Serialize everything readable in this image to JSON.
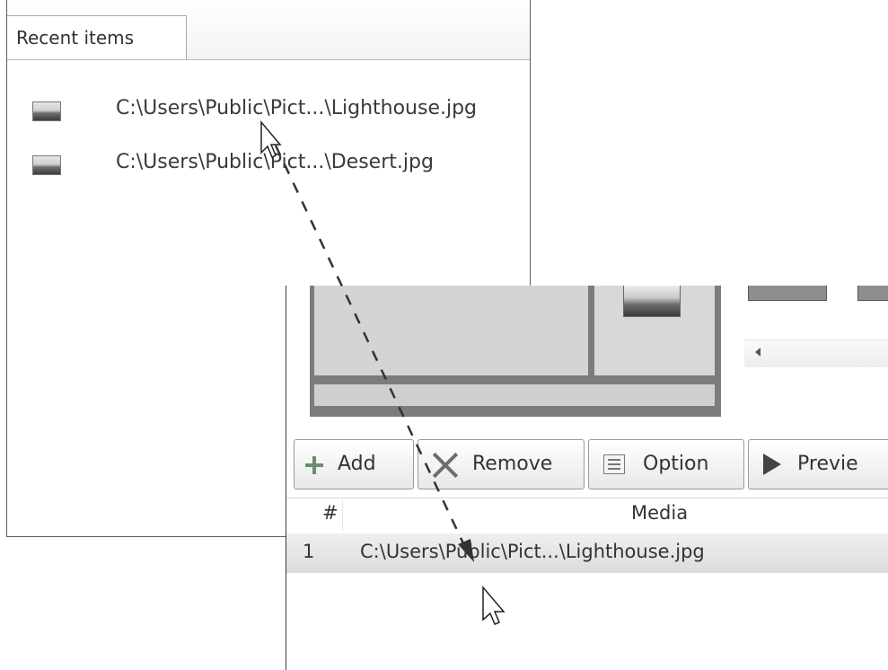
{
  "recent_window": {
    "tab_label": "Recent items",
    "items": [
      {
        "icon": "image-file-icon",
        "path": "C:\\Users\\Public\\Pict...\\Lighthouse.jpg"
      },
      {
        "icon": "image-file-icon",
        "path": "C:\\Users\\Public\\Pict...\\Desert.jpg"
      }
    ]
  },
  "editor_window": {
    "toolbar": {
      "add_label": "Add",
      "remove_label": "Remove",
      "option_label": "Option",
      "preview_label": "Previe"
    },
    "list": {
      "columns": [
        "#",
        "Media"
      ],
      "rows": [
        {
          "index": "1",
          "media": "C:\\Users\\Public\\Pict...\\Lighthouse.jpg"
        }
      ]
    }
  },
  "annotation": {
    "style": "dashed-arrow",
    "color": "#333333",
    "meaning": "drag from Recent items to media list"
  }
}
